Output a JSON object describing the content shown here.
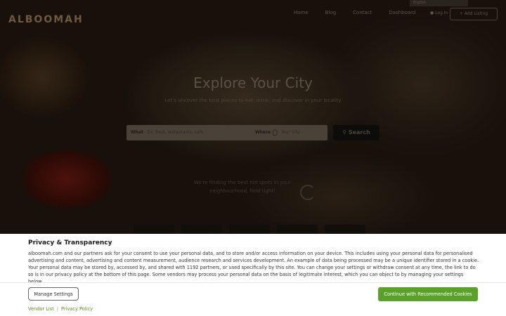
{
  "nav": {
    "logo": "ALBOOMAH",
    "links": [
      "Home",
      "Blog",
      "Contact",
      "Dashboard"
    ],
    "language": "English",
    "login": "Log In",
    "add_listing": "Add Listing"
  },
  "hero": {
    "title": "Explore Your City",
    "subtitle": "Let's uncover the best places to eat, drink, and discover in your locality",
    "search": {
      "what_label": "What",
      "what_placeholder": "Ex: food, restaurants, cafe",
      "where_label": "Where",
      "where_placeholder": "Your City...",
      "button": "Search"
    },
    "note": "We're finding the best hot spots in your neighbourhood, hold tight!"
  },
  "consent": {
    "title": "Privacy & Transparency",
    "body": "alboomah.com and our partners ask for your consent to use your personal data, and to store and/or access information on your device. This includes using your personal data for personalised advertising and content, advertising and content measurement, audience research and services development. An example of data being processed may be a unique identifier stored in a cookie. Your personal data may be stored by, accessed by, and shared with 1192 partners, or used specifically by this site. You can change your settings or withdraw consent at any time, the link to do so is in our privacy policy at the bottom of this page. Some vendors may process your personal data on the basis of legitimate interest, which you can object to by managing your settings below.",
    "manage_button": "Manage Settings",
    "continue_button": "Continue with Recommended Cookies",
    "vendor_link": "Vendor List",
    "privacy_link": "Privacy Policy"
  },
  "colors": {
    "accent_green": "#5aa12a",
    "link_green": "#5a8f1e"
  }
}
